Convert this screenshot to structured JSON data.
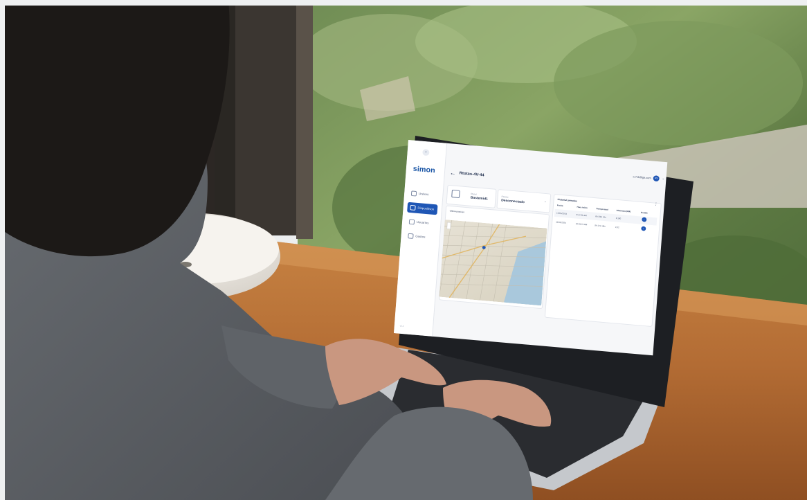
{
  "app": {
    "logo": "simon",
    "page_title": "Rtotas-4V-44",
    "user_email": "a.7sk@ga.com",
    "user_initials": "AS",
    "version": "v2.4"
  },
  "sidebar": {
    "collapse_icon": "chevron-left-icon",
    "items": [
      {
        "label": "Unirest",
        "icon": "home-icon",
        "active": false
      },
      {
        "label": "Dispositivos",
        "icon": "device-icon",
        "active": true
      },
      {
        "label": "Usuarios",
        "icon": "users-icon",
        "active": false
      },
      {
        "label": "Gastos",
        "icon": "cost-icon",
        "active": false
      }
    ]
  },
  "cards": {
    "card1": {
      "label": "Rtotal",
      "value": "Bastemid1"
    },
    "card2": {
      "label": "Estado",
      "value": "Desconectado"
    },
    "location": {
      "label": "Ultima posicion"
    }
  },
  "table": {
    "title": "Historial jornadas",
    "headers": [
      "Fecha",
      "Hora inicio",
      "Tiempo total",
      "Distancia (KM)",
      "Detalle"
    ],
    "rows": [
      [
        "12/05/2024",
        "8:17:01 AM",
        "6h 33m 15s",
        "3,100"
      ],
      [
        "11/05/2024",
        "10:04:21 AM",
        "9h 17m 48s",
        "2,02"
      ]
    ]
  },
  "colors": {
    "accent": "#1f56b5",
    "screen_bg": "#f6f7f9",
    "wood": "#b8743a",
    "sweater": "#5d6166"
  }
}
